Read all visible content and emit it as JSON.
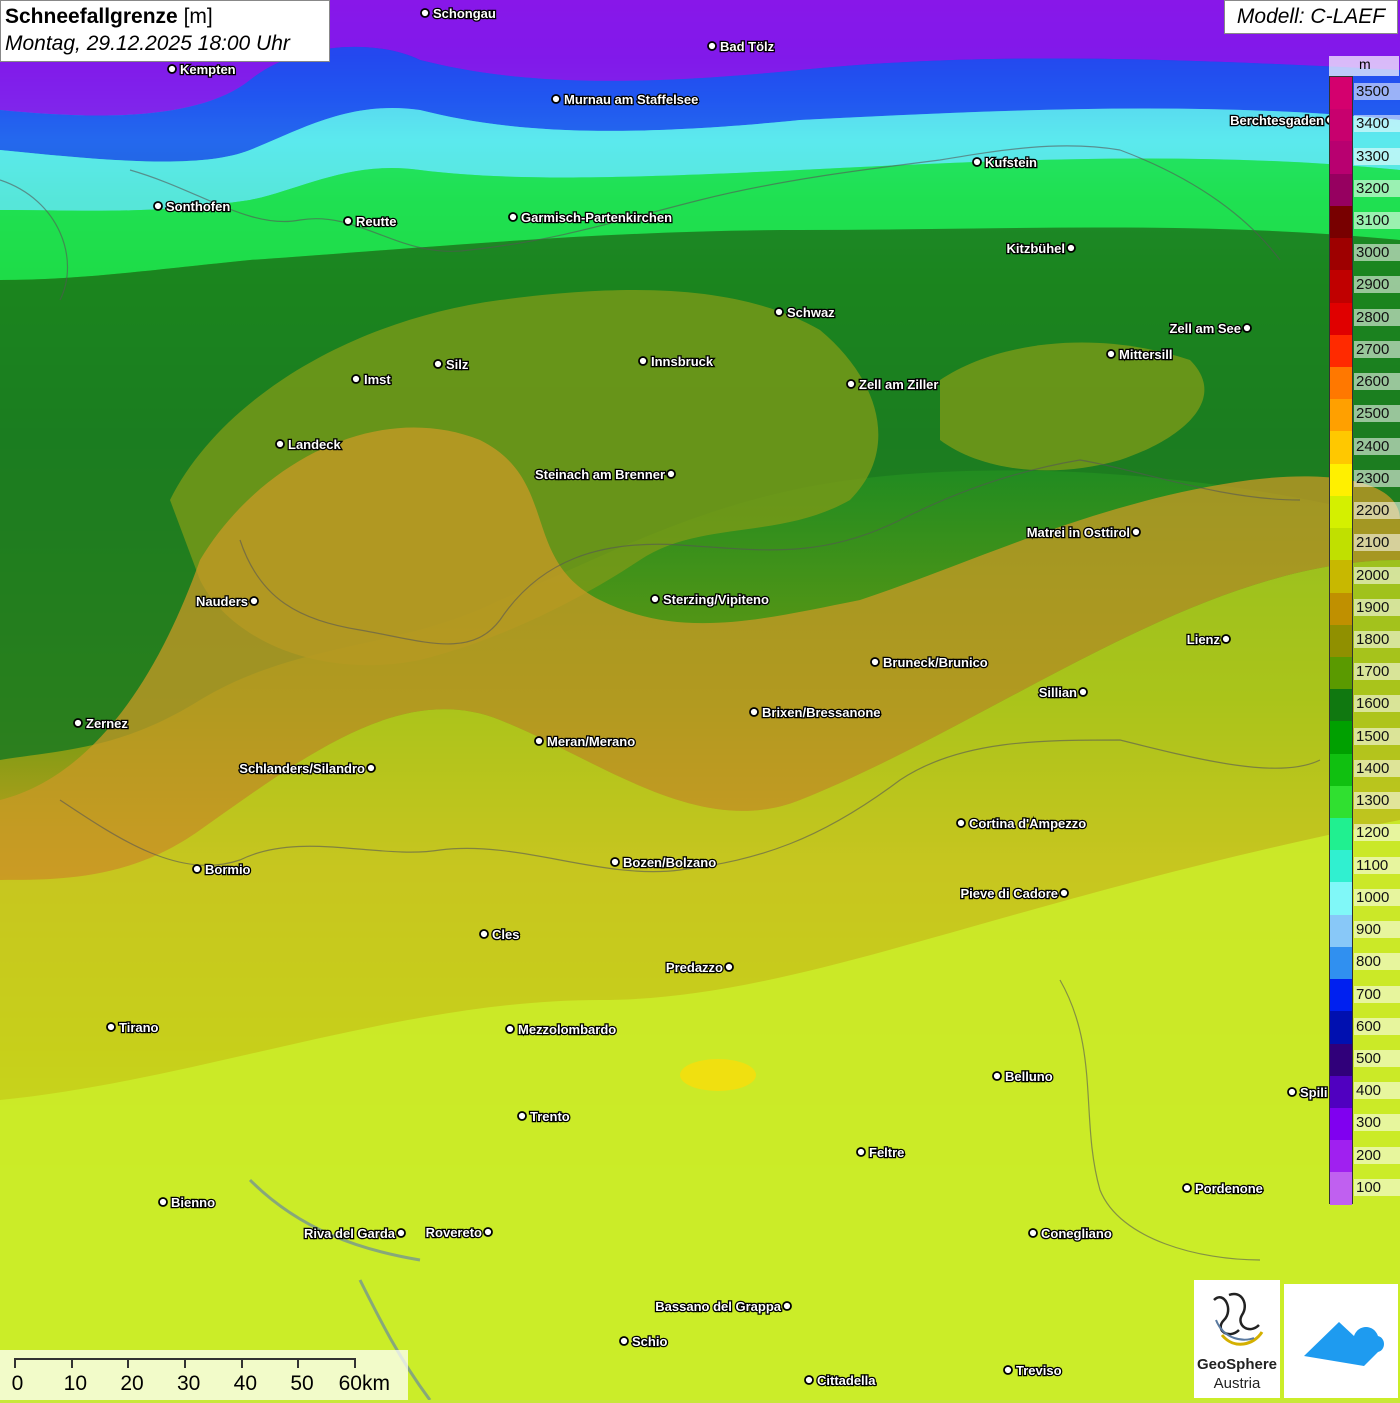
{
  "title": {
    "parameter": "Schneefallgrenze",
    "unit": "[m]",
    "datetime": "Montag, 29.12.2025 18:00 Uhr"
  },
  "model": "Modell: C-LAEF",
  "legend": {
    "unit": "m",
    "levels": [
      {
        "label": "3500",
        "color": "#d4006e"
      },
      {
        "label": "3400",
        "color": "#c8006e"
      },
      {
        "label": "3300",
        "color": "#b80070"
      },
      {
        "label": "3200",
        "color": "#960060"
      },
      {
        "label": "3100",
        "color": "#780000"
      },
      {
        "label": "3000",
        "color": "#9e0000"
      },
      {
        "label": "2900",
        "color": "#c00000"
      },
      {
        "label": "2800",
        "color": "#e00000"
      },
      {
        "label": "2700",
        "color": "#ff2a00"
      },
      {
        "label": "2600",
        "color": "#ff7800"
      },
      {
        "label": "2500",
        "color": "#ffa000"
      },
      {
        "label": "2400",
        "color": "#ffc800"
      },
      {
        "label": "2300",
        "color": "#fff000"
      },
      {
        "label": "2200",
        "color": "#d4f000"
      },
      {
        "label": "2100",
        "color": "#c0e000"
      },
      {
        "label": "2000",
        "color": "#c8b800"
      },
      {
        "label": "1900",
        "color": "#c09000"
      },
      {
        "label": "1800",
        "color": "#909000"
      },
      {
        "label": "1700",
        "color": "#5a9a00"
      },
      {
        "label": "1600",
        "color": "#107810"
      },
      {
        "label": "1500",
        "color": "#00a000"
      },
      {
        "label": "1400",
        "color": "#10c010"
      },
      {
        "label": "1300",
        "color": "#30e030"
      },
      {
        "label": "1200",
        "color": "#20f090"
      },
      {
        "label": "1100",
        "color": "#30f0d0"
      },
      {
        "label": "1000",
        "color": "#80f8f8"
      },
      {
        "label": "900",
        "color": "#88c8f8"
      },
      {
        "label": "800",
        "color": "#3090f0"
      },
      {
        "label": "700",
        "color": "#0020f0"
      },
      {
        "label": "600",
        "color": "#0010b0"
      },
      {
        "label": "500",
        "color": "#30007a"
      },
      {
        "label": "400",
        "color": "#5000c0"
      },
      {
        "label": "300",
        "color": "#8000f0"
      },
      {
        "label": "200",
        "color": "#a020f0"
      },
      {
        "label": "100",
        "color": "#c060f0"
      }
    ]
  },
  "scale": {
    "labels": [
      "0",
      "10",
      "20",
      "30",
      "40",
      "50",
      "60km"
    ]
  },
  "logos": {
    "geosphere": "GeoSphere",
    "austria": "Austria"
  },
  "cities": [
    {
      "name": "Schongau"
    },
    {
      "name": "Bad Tölz"
    },
    {
      "name": "Kempten"
    },
    {
      "name": "Murnau am Staffelsee"
    },
    {
      "name": "Berchtesgaden"
    },
    {
      "name": "Kufstein"
    },
    {
      "name": "Sonthofen"
    },
    {
      "name": "Reutte"
    },
    {
      "name": "Garmisch-Partenkirchen"
    },
    {
      "name": "Kitzbühel"
    },
    {
      "name": "Schwaz"
    },
    {
      "name": "Zell am See"
    },
    {
      "name": "Innsbruck"
    },
    {
      "name": "Imst"
    },
    {
      "name": "Silz"
    },
    {
      "name": "Mittersill"
    },
    {
      "name": "Zell am Ziller"
    },
    {
      "name": "Landeck"
    },
    {
      "name": "Steinach am Brenner"
    },
    {
      "name": "Matrei in Osttirol"
    },
    {
      "name": "Nauders"
    },
    {
      "name": "Sterzing/Vipiteno"
    },
    {
      "name": "Lienz"
    },
    {
      "name": "Bruneck/Brunico"
    },
    {
      "name": "Sillian"
    },
    {
      "name": "Zernez"
    },
    {
      "name": "Brixen/Bressanone"
    },
    {
      "name": "Meran/Merano"
    },
    {
      "name": "Schlanders/Silandro"
    },
    {
      "name": "Cortina d'Ampezzo"
    },
    {
      "name": "Bozen/Bolzano"
    },
    {
      "name": "Bormio"
    },
    {
      "name": "Pieve di Cadore"
    },
    {
      "name": "Cles"
    },
    {
      "name": "Predazzo"
    },
    {
      "name": "Tirano"
    },
    {
      "name": "Mezzolombardo"
    },
    {
      "name": "Belluno"
    },
    {
      "name": "Spili"
    },
    {
      "name": "Trento"
    },
    {
      "name": "Feltre"
    },
    {
      "name": "Pordenone"
    },
    {
      "name": "Bienno"
    },
    {
      "name": "Riva del Garda"
    },
    {
      "name": "Rovereto"
    },
    {
      "name": "Conegliano"
    },
    {
      "name": "Bassano del Grappa"
    },
    {
      "name": "Schio"
    },
    {
      "name": "Treviso"
    },
    {
      "name": "Cittadella"
    }
  ]
}
